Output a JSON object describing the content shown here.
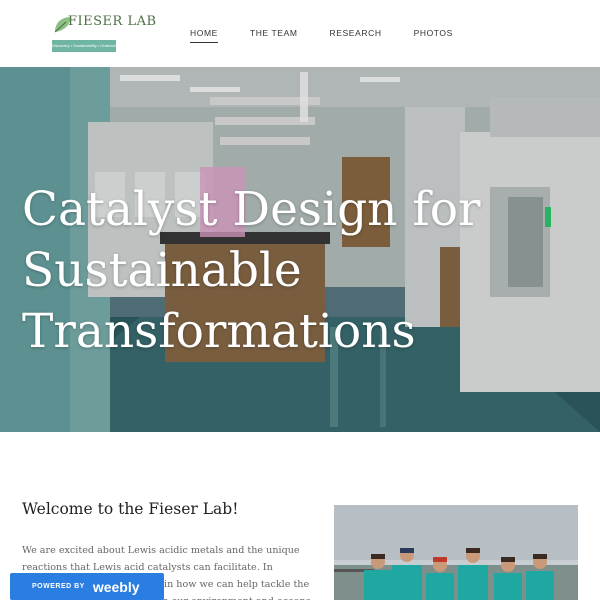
{
  "logo": {
    "title": "FIESER LAB",
    "tagline": "Discovery • Sustainability • Outreach"
  },
  "nav": {
    "items": [
      {
        "label": "HOME",
        "active": true
      },
      {
        "label": "THE TEAM",
        "active": false
      },
      {
        "label": "RESEARCH",
        "active": false
      },
      {
        "label": "PHOTOS",
        "active": false
      }
    ]
  },
  "hero": {
    "title": "Catalyst Design for\nSustainable\nTransformations"
  },
  "welcome": {
    "heading": "Welcome to the Fieser Lab!",
    "body": "We are excited about Lewis acidic metals and the unique reactions that Lewis acid catalysts can facilitate. In particular, we are interested in how we can help tackle the problem of plastic pollution in our environment and oceans."
  },
  "badge": {
    "powered": "POWERED BY",
    "brand": "weebly"
  },
  "colors": {
    "accent_blue": "#2a7de1",
    "logo_green": "#4d6f45",
    "logo_teal": "#6fb5a3"
  }
}
